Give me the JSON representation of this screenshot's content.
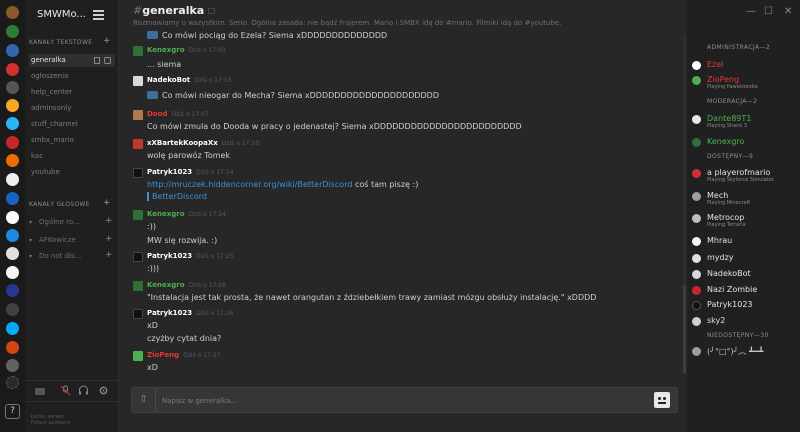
{
  "server": {
    "name": "SMWMo...",
    "categories": {
      "text": "KANAŁY TEKSTOWE",
      "voice": "KANAŁY GŁOSOWE"
    },
    "text_channels": [
      "generalka",
      "ogłoszenia",
      "help_center",
      "adminsonly",
      "stuff_channel",
      "smbx_mario",
      "kac",
      "youtube"
    ],
    "voice_channels": [
      "Ogólne ro...",
      "AFKowicze",
      "Do not dis..."
    ],
    "status_lines": [
      "Łatwy serwer",
      "Połącz aplikacje"
    ]
  },
  "channel": {
    "title": "generalka",
    "topic": "Rozmawiamy o wszystkim. Serio. Ogólna zasada: nie bądź frajerem. Mario i SMBX idą do #mario. Filmiki idą do #youtube."
  },
  "messages": [
    {
      "kind": "line",
      "text": "Co mówi pociąg do Ezela? Siema xDDDDDDDDDDDDDD",
      "badge": true
    },
    {
      "kind": "author",
      "author": "Kenexgro",
      "time": "Dziś o 17:03",
      "color": "#4caf50",
      "avatar": "#2f6f3a"
    },
    {
      "kind": "line",
      "text": "... siema",
      "badge": false
    },
    {
      "kind": "author",
      "author": "NadekoBot",
      "time": "Dziś o 17:03",
      "color": "#ffffff",
      "avatar": "#d8d8d8"
    },
    {
      "kind": "line",
      "text": "Co mówi nieogar do Mecha? Siema xDDDDDDDDDDDDDDDDDDDDD",
      "badge": true
    },
    {
      "kind": "author",
      "author": "Dood",
      "time": "Dziś o 17:07",
      "color": "#e53935",
      "avatar": "#b3794b"
    },
    {
      "kind": "line",
      "text": "Co mówi zmula do Dooda w pracy o jedenastej? Siema xDDDDDDDDDDDDDDDDDDDDDDDD",
      "badge": false
    },
    {
      "kind": "author",
      "author": "xXBartekKoopaXx",
      "time": "Dziś o 17:10",
      "color": "#ffffff",
      "avatar": "#c0392b"
    },
    {
      "kind": "line",
      "text": "wolę parowóz Tomek",
      "badge": false
    },
    {
      "kind": "author",
      "author": "Patryk1023",
      "time": "Dziś o 17:24",
      "color": "#ffffff",
      "avatar": "#111111"
    },
    {
      "kind": "link",
      "url": "http://mruczek.hiddencorner.org/wiki/BetterDiscord",
      "rest": " coś tam piszę :)"
    },
    {
      "kind": "embed",
      "text": "BetterDiscord"
    },
    {
      "kind": "author",
      "author": "Kenexgro",
      "time": "Dziś o 17:24",
      "color": "#4caf50",
      "avatar": "#2f6f3a"
    },
    {
      "kind": "line",
      "text": ":))",
      "badge": false
    },
    {
      "kind": "line",
      "text": "MW się rozwija. :)",
      "badge": false
    },
    {
      "kind": "author",
      "author": "Patryk1023",
      "time": "Dziś o 17:25",
      "color": "#ffffff",
      "avatar": "#111111"
    },
    {
      "kind": "line",
      "text": ":)))",
      "badge": false
    },
    {
      "kind": "author",
      "author": "Kenexgro",
      "time": "Dziś o 17:26",
      "color": "#4caf50",
      "avatar": "#2f6f3a"
    },
    {
      "kind": "line",
      "text": "\"Instalacja jest tak prosta, że nawet orangutan z ździebełkiem trawy zamiast mózgu obsłuży instalację.\" xDDDD",
      "badge": false
    },
    {
      "kind": "author",
      "author": "Patryk1023",
      "time": "Dziś o 17:26",
      "color": "#ffffff",
      "avatar": "#111111"
    },
    {
      "kind": "line",
      "text": "xD",
      "badge": false
    },
    {
      "kind": "line",
      "text": "czyżby cytat dnia?",
      "badge": false
    },
    {
      "kind": "author",
      "author": "ZioPeng",
      "time": "Dziś o 17:27",
      "color": "#e53935",
      "avatar": "#4caf50"
    },
    {
      "kind": "line",
      "text": "xD",
      "badge": false
    }
  ],
  "compose": {
    "placeholder": "Napisz w generalka..."
  },
  "members": {
    "sections": [
      {
        "role": "ADMINISTRACJA—2",
        "users": [
          {
            "name": "Ezel",
            "color": "#e53935",
            "game": ""
          },
          {
            "name": "ZioPeng",
            "color": "#e53935",
            "game": "Playing Pawełzondia"
          }
        ]
      },
      {
        "role": "MODERACJA—2",
        "users": [
          {
            "name": "Dante89T1",
            "color": "#4caf50",
            "game": "Playing Shank 3"
          },
          {
            "name": "Kenexgro",
            "color": "#4caf50",
            "game": ""
          }
        ]
      },
      {
        "role": "DOSTĘPNY—9",
        "users": [
          {
            "name": "a playerofmario",
            "color": "#e2e2e2",
            "game": "Playing Skyforce Simulator"
          },
          {
            "name": "Mech",
            "color": "#e2e2e2",
            "game": "Playing Minecraft"
          },
          {
            "name": "Metrocop",
            "color": "#e2e2e2",
            "game": "Playing Terraria"
          },
          {
            "name": "Mhrau",
            "color": "#e2e2e2",
            "game": ""
          },
          {
            "name": "mydzy",
            "color": "#e2e2e2",
            "game": ""
          },
          {
            "name": "NadekoBot",
            "color": "#e2e2e2",
            "game": ""
          },
          {
            "name": "Nazi Zombie",
            "color": "#e2e2e2",
            "game": ""
          },
          {
            "name": "Patryk1023",
            "color": "#e2e2e2",
            "game": ""
          },
          {
            "name": "sky2",
            "color": "#e2e2e2",
            "game": ""
          }
        ]
      },
      {
        "role": "NIEDOSTĘPNY—30",
        "users": [
          {
            "name": "(╯°□°)╯︵ ┻━┻",
            "color": "#c8c8c8",
            "game": ""
          }
        ]
      }
    ]
  },
  "window": {
    "minimize": "—",
    "maximize": "☐",
    "close": "✕"
  }
}
